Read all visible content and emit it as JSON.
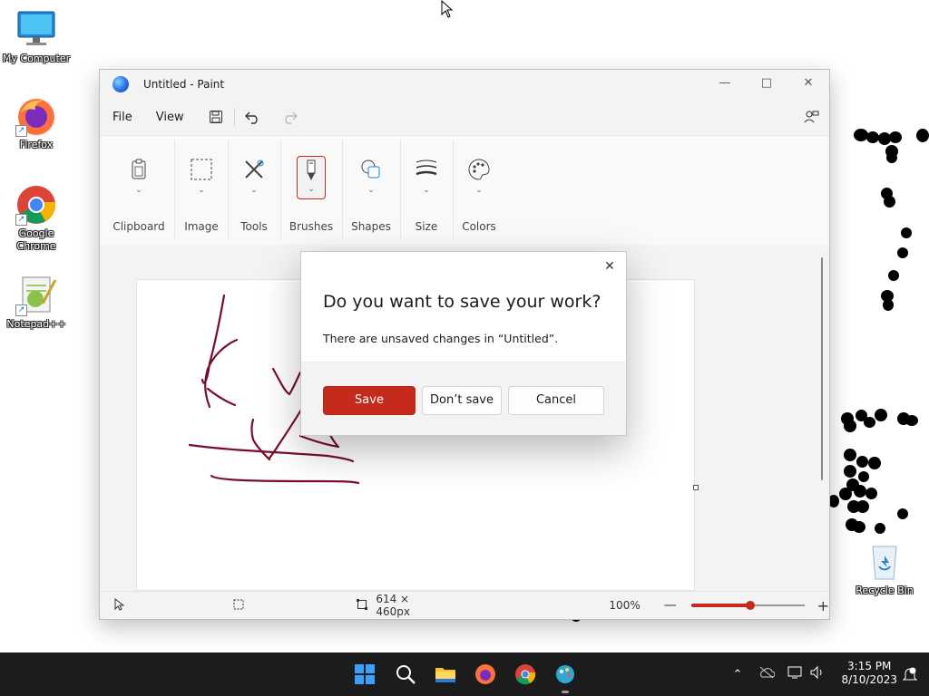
{
  "desktop": {
    "icons": [
      {
        "label": "My Computer"
      },
      {
        "label": "Firefox"
      },
      {
        "label": "Google Chrome"
      },
      {
        "label": "Notepad++"
      },
      {
        "label": "Recycle Bin"
      }
    ]
  },
  "window": {
    "title": "Untitled - Paint",
    "menu": {
      "file": "File",
      "view": "View"
    },
    "ribbon": {
      "groups": [
        {
          "label": "Clipboard",
          "icon": "clipboard-icon"
        },
        {
          "label": "Image",
          "icon": "selection-icon"
        },
        {
          "label": "Tools",
          "icon": "tools-icon"
        },
        {
          "label": "Brushes",
          "icon": "brush-icon"
        },
        {
          "label": "Shapes",
          "icon": "shapes-icon"
        },
        {
          "label": "Size",
          "icon": "size-icon"
        },
        {
          "label": "Colors",
          "icon": "palette-icon"
        }
      ]
    },
    "status": {
      "canvas_size": "614 × 460px",
      "zoom": "100%",
      "zoom_fraction": 0.5
    },
    "brush_color": "#7a0e2a",
    "accent": "#c42b1c"
  },
  "dialog": {
    "title": "Do you want to save your work?",
    "message": "There are unsaved changes in “Untitled”.",
    "save": "Save",
    "dont_save": "Don’t save",
    "cancel": "Cancel"
  },
  "taskbar": {
    "time": "3:15 PM",
    "date": "8/10/2023"
  }
}
